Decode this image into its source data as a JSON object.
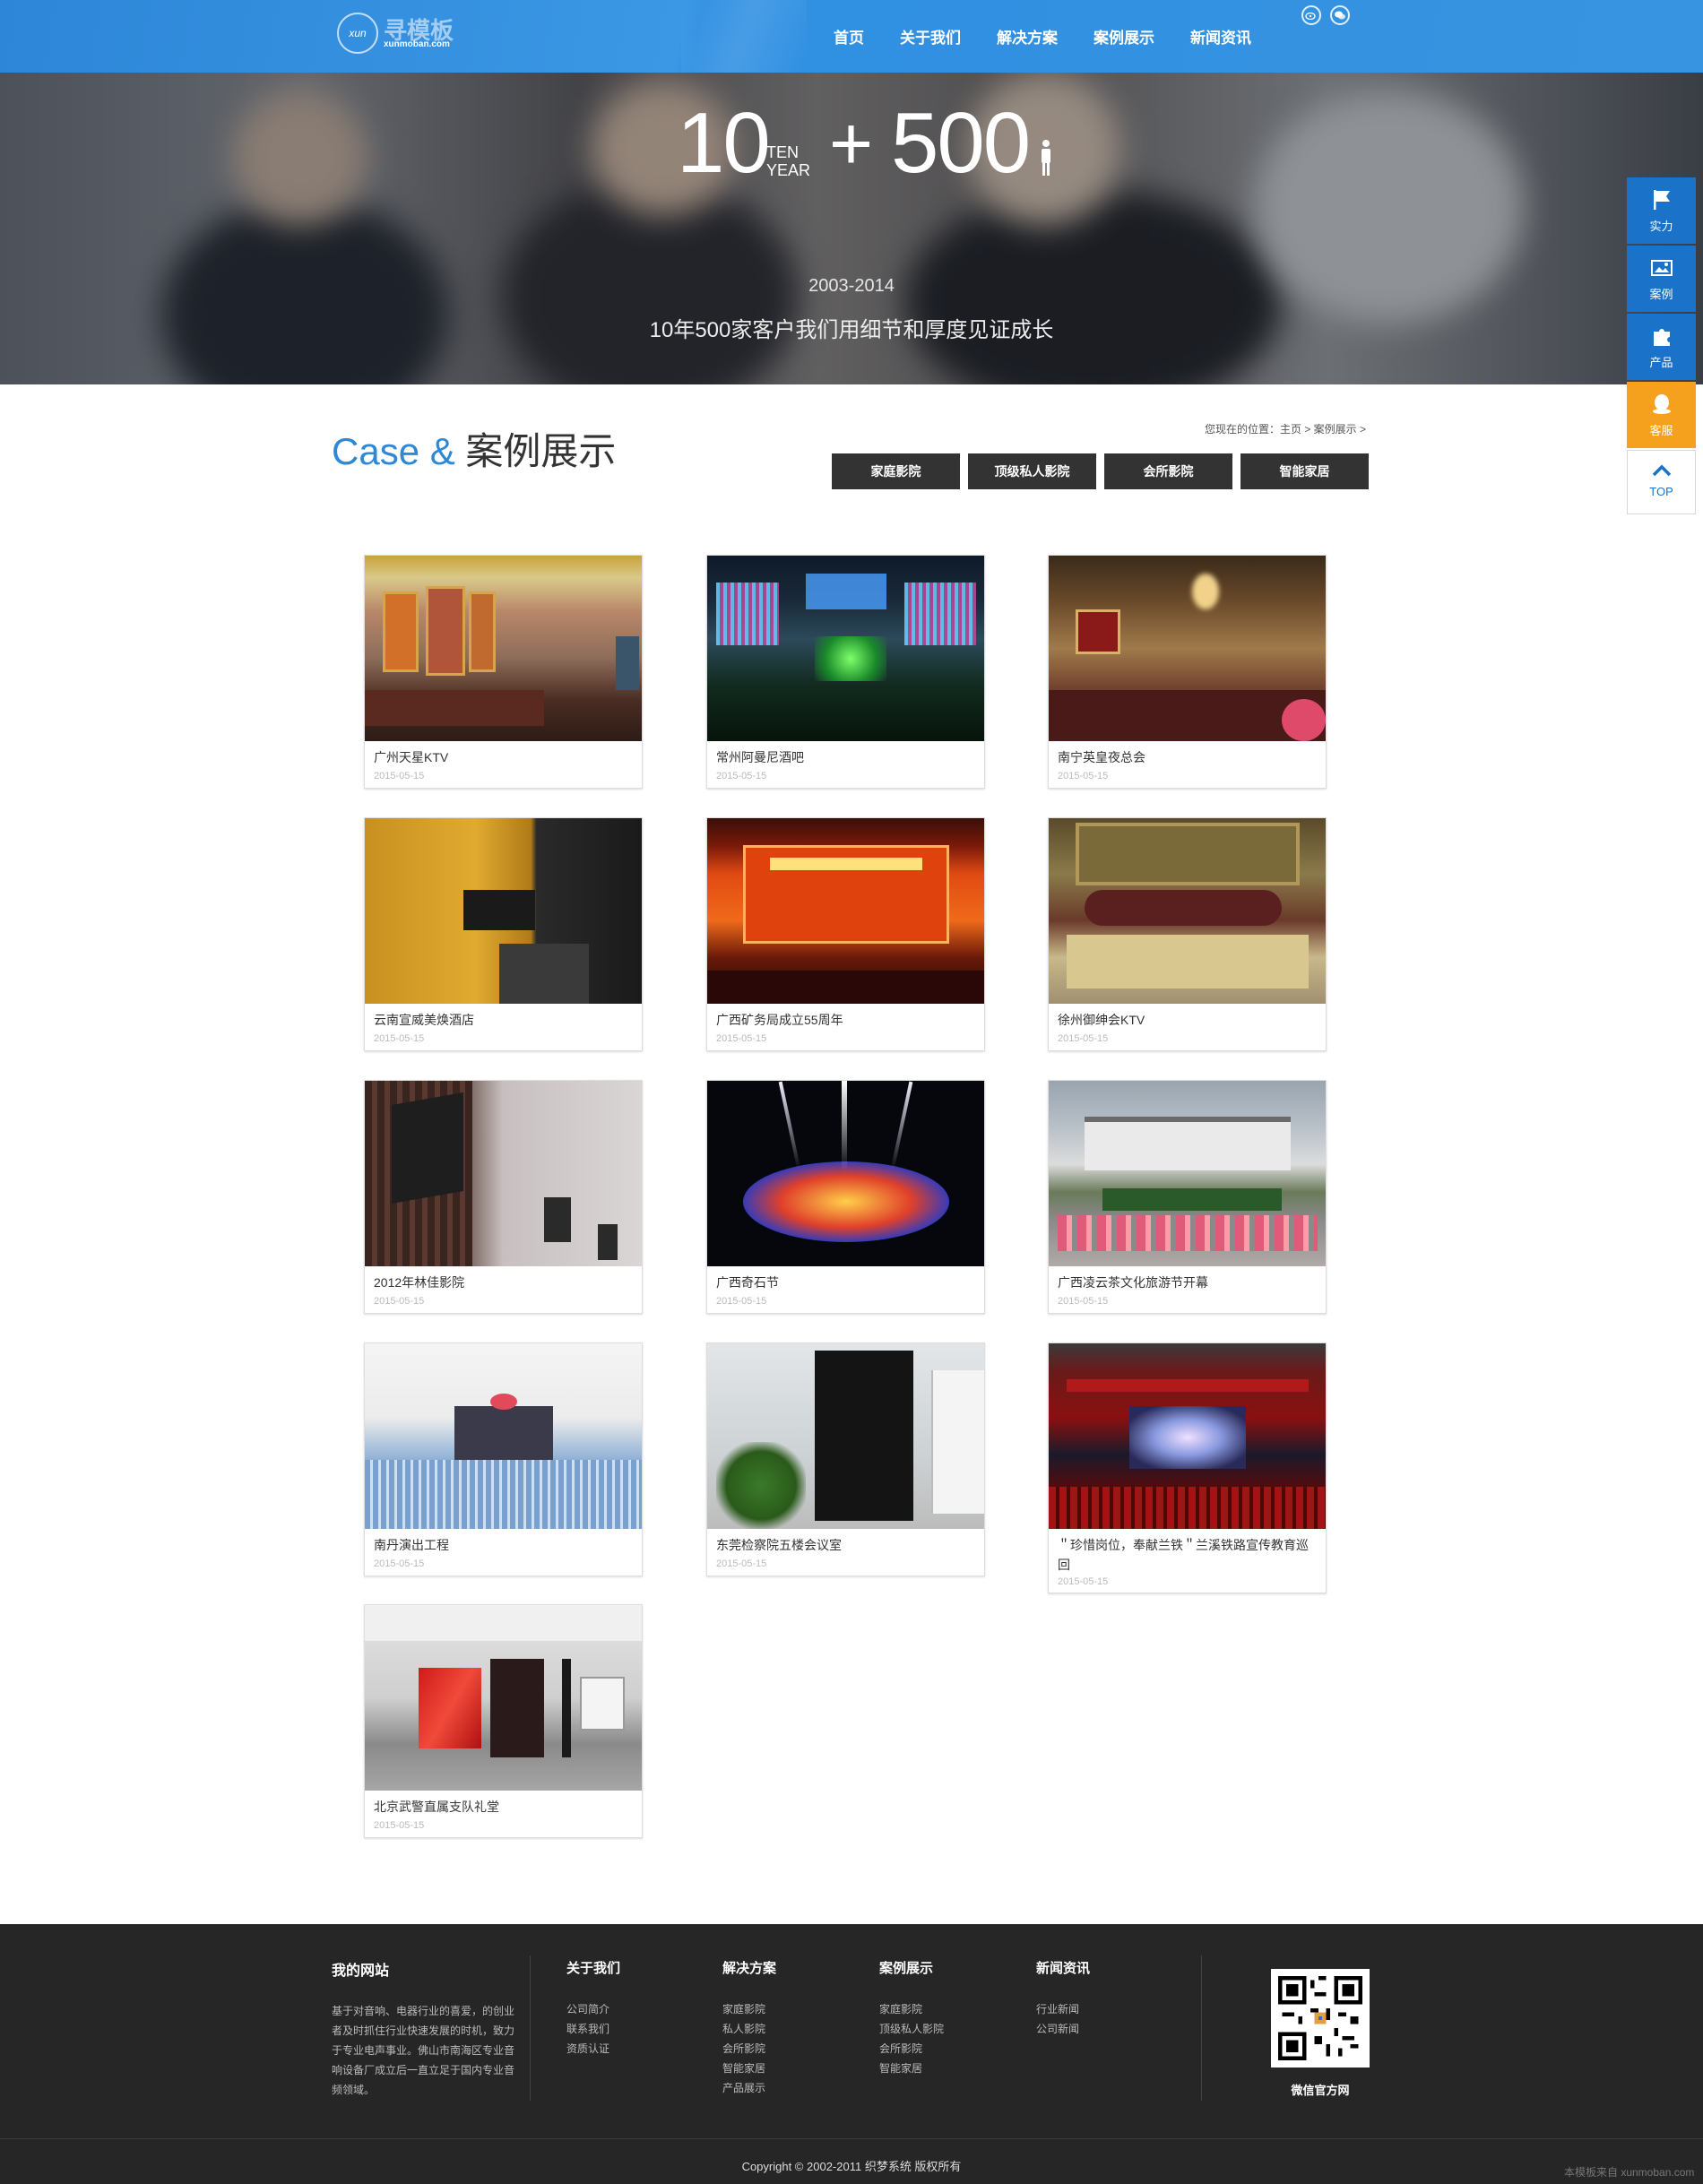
{
  "header": {
    "logo_mark": "xun",
    "logo_cn": "寻模板",
    "logo_en": "xunmoban.com",
    "nav": [
      "首页",
      "关于我们",
      "解决方案",
      "案例展示",
      "新闻资讯"
    ],
    "colors": {
      "header": "#3594e0",
      "accent": "#1a73c8",
      "orange": "#f5a11d"
    }
  },
  "banner": {
    "big1": "10",
    "ten": "TEN",
    "year": "YEAR",
    "plus": "+",
    "big2": "500",
    "years": "2003-2014",
    "slogan": "10年500家客户我们用细节和厚度见证成长"
  },
  "float": [
    "实力",
    "案例",
    "产品",
    "客服",
    "TOP"
  ],
  "section": {
    "title_en": "Case & ",
    "title_cn": "案例展示",
    "breadcrumb": "您现在的位置：主页 > 案例展示 >",
    "tabs": [
      "家庭影院",
      "顶级私人影院",
      "会所影院",
      "智能家居"
    ]
  },
  "cases": [
    {
      "title": "广州天星KTV",
      "date": "2015-05-15"
    },
    {
      "title": "常州阿曼尼酒吧",
      "date": "2015-05-15"
    },
    {
      "title": "南宁英皇夜总会",
      "date": "2015-05-15"
    },
    {
      "title": "云南宣威美焕酒店",
      "date": "2015-05-15"
    },
    {
      "title": "广西矿务局成立55周年",
      "date": "2015-05-15"
    },
    {
      "title": "徐州御绅会KTV",
      "date": "2015-05-15"
    },
    {
      "title": "2012年林佳影院",
      "date": "2015-05-15"
    },
    {
      "title": "广西奇石节",
      "date": "2015-05-15"
    },
    {
      "title": "广西凌云茶文化旅游节开幕",
      "date": "2015-05-15"
    },
    {
      "title": "南丹演出工程",
      "date": "2015-05-15"
    },
    {
      "title": "东莞检察院五楼会议室",
      "date": "2015-05-15"
    },
    {
      "title": "＂珍惜岗位，奉献兰铁＂兰溪铁路宣传教育巡回",
      "date": "2015-05-15"
    },
    {
      "title": "北京武警直属支队礼堂",
      "date": "2015-05-15"
    }
  ],
  "footer": {
    "site_title": "我的网站",
    "about": "基于对音响、电器行业的喜爱，的创业者及时抓住行业快速发展的时机，致力于专业电声事业。佛山市南海区专业音响设备厂成立后一直立足于国内专业音频领域。",
    "cols": [
      {
        "title": "关于我们",
        "items": [
          "公司简介",
          "联系我们",
          "资质认证"
        ]
      },
      {
        "title": "解决方案",
        "items": [
          "家庭影院",
          "私人影院",
          "会所影院",
          "智能家居",
          "产品展示"
        ]
      },
      {
        "title": "案例展示",
        "items": [
          "家庭影院",
          "顶级私人影院",
          "会所影院",
          "智能家居"
        ]
      },
      {
        "title": "新闻资讯",
        "items": [
          "行业新闻",
          "公司新闻"
        ]
      }
    ],
    "qr_label": "微信官方网",
    "copyright": "Copyright © 2002-2011 织梦系统 版权所有",
    "watermark": "本模板来自 xunmoban.com"
  }
}
